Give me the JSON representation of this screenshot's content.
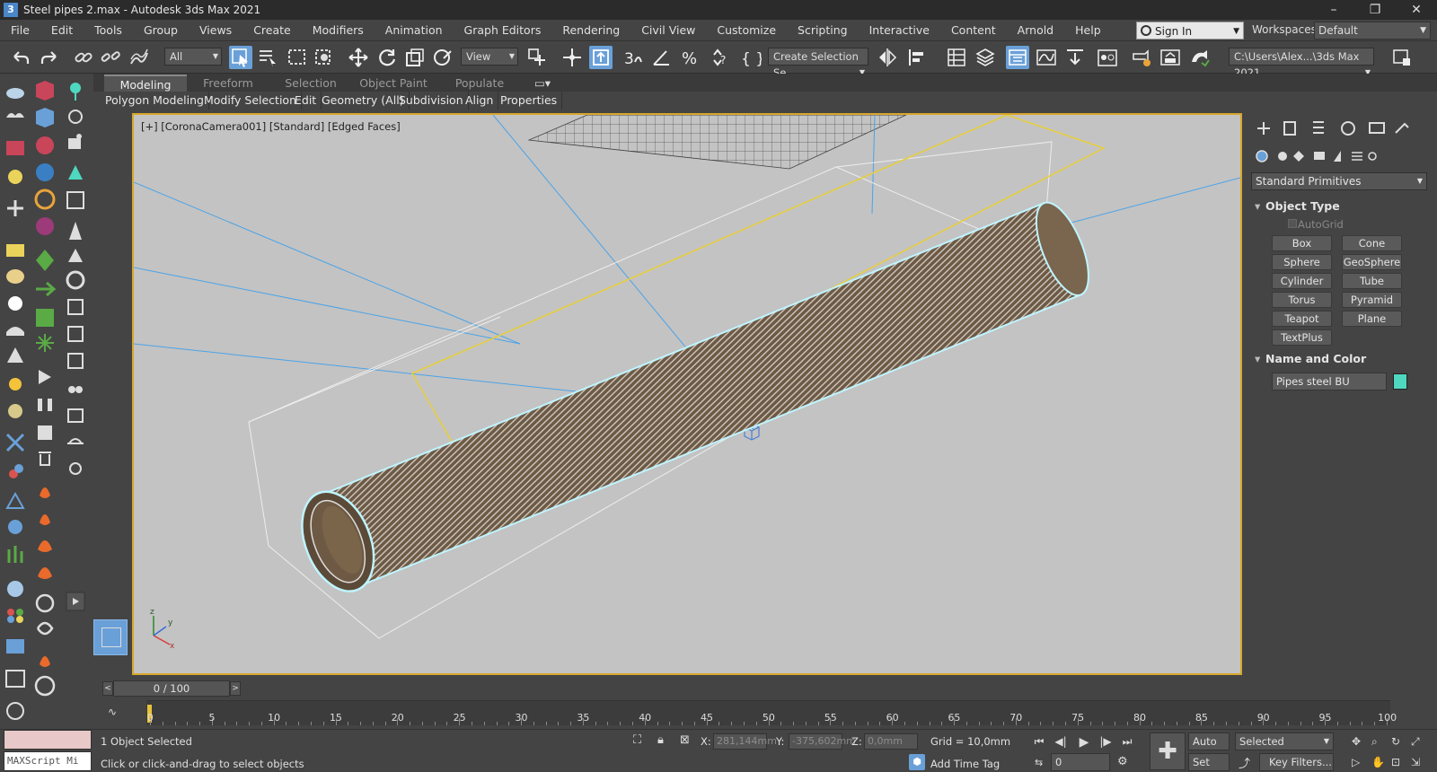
{
  "window": {
    "title": "Steel pipes 2.max - Autodesk 3ds Max 2021",
    "app_icon": "3",
    "minimize": "–",
    "maximize": "❐",
    "close": "✕"
  },
  "menu": [
    "File",
    "Edit",
    "Tools",
    "Group",
    "Views",
    "Create",
    "Modifiers",
    "Animation",
    "Graph Editors",
    "Rendering",
    "Civil View",
    "Customize",
    "Scripting",
    "Interactive",
    "Content",
    "Arnold",
    "Help"
  ],
  "account": {
    "signin": "Sign In",
    "workspaces_label": "Workspaces:",
    "workspace": "Default"
  },
  "toolbar": {
    "filter": "All",
    "ref_coord": "View",
    "selection_set": "Create Selection Se",
    "project_path": "C:\\Users\\Alex...\\3ds Max 2021"
  },
  "ribbon": {
    "tabs": [
      "Modeling",
      "Freeform",
      "Selection",
      "Object Paint",
      "Populate"
    ],
    "subtabs": [
      "Polygon Modeling",
      "Modify Selection",
      "Edit",
      "Geometry (All)",
      "Subdivision",
      "Align",
      "Properties"
    ]
  },
  "viewport": {
    "label": "[+] [CoronaCamera001] [Standard] [Edged Faces]"
  },
  "command_panel": {
    "primitive_type": "Standard Primitives",
    "object_type_title": "Object Type",
    "autogrid": "AutoGrid",
    "buttons": [
      "Box",
      "Cone",
      "Sphere",
      "GeoSphere",
      "Cylinder",
      "Tube",
      "Torus",
      "Pyramid",
      "Teapot",
      "Plane",
      "TextPlus"
    ],
    "name_color_title": "Name and Color",
    "object_name": "Pipes steel BU",
    "object_color": "#4fd8c0"
  },
  "timeline": {
    "slider": "0 / 100",
    "ticks": [
      "0",
      "5",
      "10",
      "15",
      "20",
      "25",
      "30",
      "35",
      "40",
      "45",
      "50",
      "55",
      "60",
      "65",
      "70",
      "75",
      "80",
      "85",
      "90",
      "95",
      "100"
    ]
  },
  "status": {
    "selected": "1 Object Selected",
    "prompt": "Click or click-and-drag to select objects",
    "x_label": "X:",
    "x_value": "281,144mm",
    "y_label": "Y:",
    "y_value": "-375,602mm",
    "z_label": "Z:",
    "z_value": "0,0mm",
    "grid": "Grid = 10,0mm",
    "add_time_tag": "Add Time Tag",
    "auto_key": "Auto K...",
    "key_mode": "Selected",
    "set_key": "Set Key",
    "key_filters": "Key Filters...",
    "frame": "0",
    "maxscript": "MAXScript Mi"
  },
  "colors": {
    "accent": "#6aa0d8",
    "viewport_border": "#d9a72c",
    "selection": "#bff4ff"
  }
}
